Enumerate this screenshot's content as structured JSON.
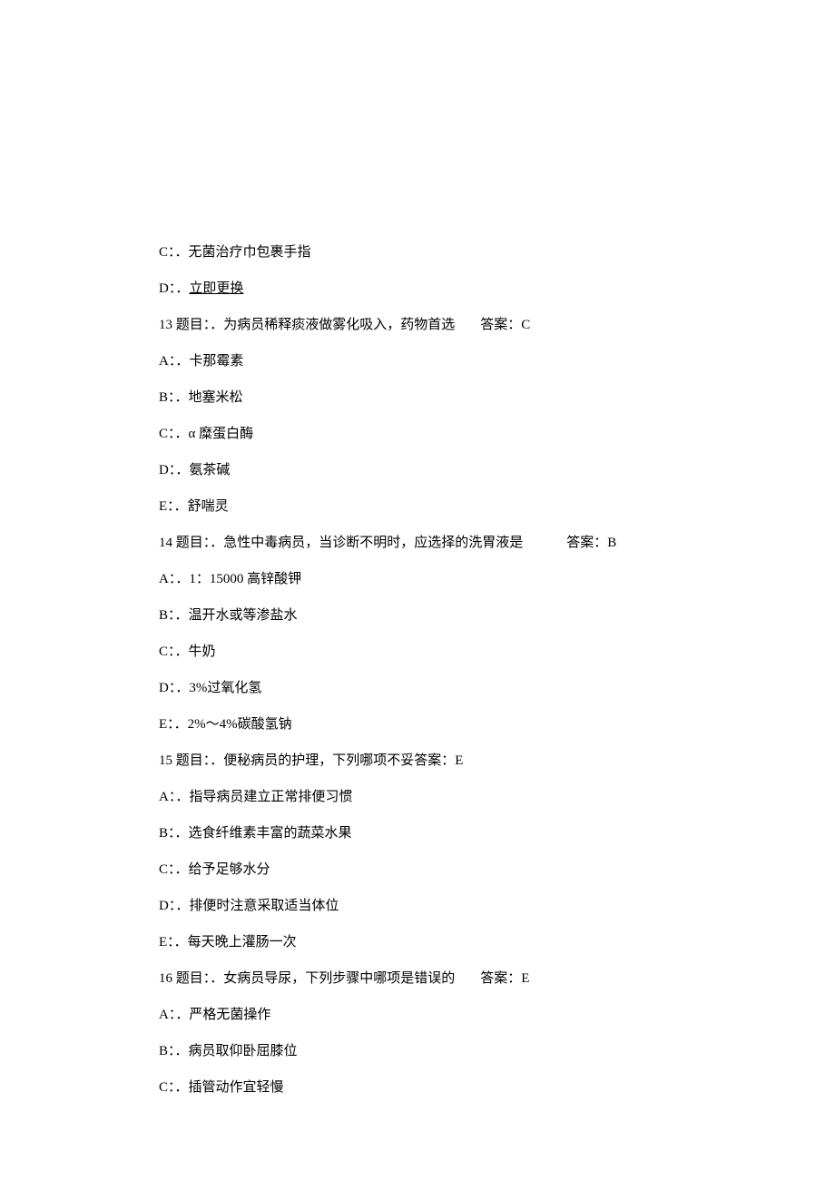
{
  "lines": {
    "opt_c_prev": "C：．无菌治疗巾包裹手指",
    "opt_d_prev_prefix": "D：．",
    "opt_d_prev_text": "立即更换",
    "q13_text": "13 题目：．为病员稀释痰液做雾化吸入，药物首选",
    "q13_answer": "答案：C",
    "q13_a": "A：．卡那霉素",
    "q13_b": "B：．地塞米松",
    "q13_c": "C：．α 糜蛋白酶",
    "q13_d": "D：．氨茶碱",
    "q13_e": "E：．舒喘灵",
    "q14_text": "14 题目：．急性中毒病员，当诊断不明时，应选择的洗胃液是",
    "q14_answer": "答案：B",
    "q14_a": "A：．1：15000 高锌酸钾",
    "q14_b": "B：．温开水或等渗盐水",
    "q14_c": "C：．牛奶",
    "q14_d": "D：．3%过氧化氢",
    "q14_e": "E：．2%～4%碳酸氢钠",
    "q15_text": "15 题目：．便秘病员的护理，下列哪项不妥答案：E",
    "q15_a": "A：．指导病员建立正常排便习惯",
    "q15_b": "B：．选食纤维素丰富的蔬菜水果",
    "q15_c": "C：．给予足够水分",
    "q15_d": "D：．排便时注意采取适当体位",
    "q15_e": "E：．每天晚上灌肠一次",
    "q16_text": "16 题目：．女病员导尿，下列步骤中哪项是错误的",
    "q16_answer": "答案：E",
    "q16_a": "A：．严格无菌操作",
    "q16_b": "B：．病员取仰卧屈膝位",
    "q16_c": "C：．插管动作宜轻慢"
  }
}
